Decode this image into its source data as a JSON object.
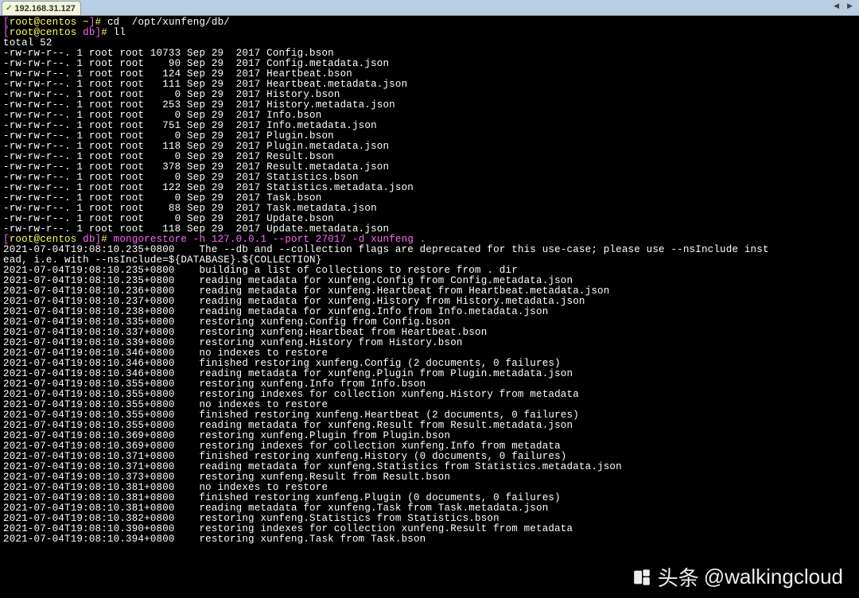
{
  "tab": {
    "label": "192.168.31.127",
    "check": "✓"
  },
  "tab_controls": {
    "left": "◀",
    "right": "▶"
  },
  "prompt": {
    "lb": "[",
    "rb": "]",
    "user": "root",
    "at": "@",
    "host": "centos",
    "hash": "#",
    "tilde": "~",
    "db": "db"
  },
  "cmds": {
    "cd": "cd  /opt/xunfeng/db/",
    "ll": "ll",
    "mongo": "mongorestore -h 127.0.0.1 --port 27017 -d xunfeng ."
  },
  "files_header": "total 52",
  "files": [
    {
      "perm": "-rw-rw-r--.",
      "n": "1",
      "o": "root",
      "g": "root",
      "size": "10733",
      "m": "Sep",
      "d": "29",
      "y": "2017",
      "name": "Config.bson"
    },
    {
      "perm": "-rw-rw-r--.",
      "n": "1",
      "o": "root",
      "g": "root",
      "size": "90",
      "m": "Sep",
      "d": "29",
      "y": "2017",
      "name": "Config.metadata.json"
    },
    {
      "perm": "-rw-rw-r--.",
      "n": "1",
      "o": "root",
      "g": "root",
      "size": "124",
      "m": "Sep",
      "d": "29",
      "y": "2017",
      "name": "Heartbeat.bson"
    },
    {
      "perm": "-rw-rw-r--.",
      "n": "1",
      "o": "root",
      "g": "root",
      "size": "111",
      "m": "Sep",
      "d": "29",
      "y": "2017",
      "name": "Heartbeat.metadata.json"
    },
    {
      "perm": "-rw-rw-r--.",
      "n": "1",
      "o": "root",
      "g": "root",
      "size": "0",
      "m": "Sep",
      "d": "29",
      "y": "2017",
      "name": "History.bson"
    },
    {
      "perm": "-rw-rw-r--.",
      "n": "1",
      "o": "root",
      "g": "root",
      "size": "253",
      "m": "Sep",
      "d": "29",
      "y": "2017",
      "name": "History.metadata.json"
    },
    {
      "perm": "-rw-rw-r--.",
      "n": "1",
      "o": "root",
      "g": "root",
      "size": "0",
      "m": "Sep",
      "d": "29",
      "y": "2017",
      "name": "Info.bson"
    },
    {
      "perm": "-rw-rw-r--.",
      "n": "1",
      "o": "root",
      "g": "root",
      "size": "751",
      "m": "Sep",
      "d": "29",
      "y": "2017",
      "name": "Info.metadata.json"
    },
    {
      "perm": "-rw-rw-r--.",
      "n": "1",
      "o": "root",
      "g": "root",
      "size": "0",
      "m": "Sep",
      "d": "29",
      "y": "2017",
      "name": "Plugin.bson"
    },
    {
      "perm": "-rw-rw-r--.",
      "n": "1",
      "o": "root",
      "g": "root",
      "size": "118",
      "m": "Sep",
      "d": "29",
      "y": "2017",
      "name": "Plugin.metadata.json"
    },
    {
      "perm": "-rw-rw-r--.",
      "n": "1",
      "o": "root",
      "g": "root",
      "size": "0",
      "m": "Sep",
      "d": "29",
      "y": "2017",
      "name": "Result.bson"
    },
    {
      "perm": "-rw-rw-r--.",
      "n": "1",
      "o": "root",
      "g": "root",
      "size": "378",
      "m": "Sep",
      "d": "29",
      "y": "2017",
      "name": "Result.metadata.json"
    },
    {
      "perm": "-rw-rw-r--.",
      "n": "1",
      "o": "root",
      "g": "root",
      "size": "0",
      "m": "Sep",
      "d": "29",
      "y": "2017",
      "name": "Statistics.bson"
    },
    {
      "perm": "-rw-rw-r--.",
      "n": "1",
      "o": "root",
      "g": "root",
      "size": "122",
      "m": "Sep",
      "d": "29",
      "y": "2017",
      "name": "Statistics.metadata.json"
    },
    {
      "perm": "-rw-rw-r--.",
      "n": "1",
      "o": "root",
      "g": "root",
      "size": "0",
      "m": "Sep",
      "d": "29",
      "y": "2017",
      "name": "Task.bson"
    },
    {
      "perm": "-rw-rw-r--.",
      "n": "1",
      "o": "root",
      "g": "root",
      "size": "88",
      "m": "Sep",
      "d": "29",
      "y": "2017",
      "name": "Task.metadata.json"
    },
    {
      "perm": "-rw-rw-r--.",
      "n": "1",
      "o": "root",
      "g": "root",
      "size": "0",
      "m": "Sep",
      "d": "29",
      "y": "2017",
      "name": "Update.bson"
    },
    {
      "perm": "-rw-rw-r--.",
      "n": "1",
      "o": "root",
      "g": "root",
      "size": "118",
      "m": "Sep",
      "d": "29",
      "y": "2017",
      "name": "Update.metadata.json"
    }
  ],
  "log_lines": [
    {
      "ts": "2021-07-04T19:08:10.235+0800",
      "msg": "The --db and --collection flags are deprecated for this use-case; please use --nsInclude inst"
    },
    {
      "ts": "ead, i.e. with --nsInclude=${DATABASE}.${COLLECTION}",
      "msg": ""
    },
    {
      "ts": "2021-07-04T19:08:10.235+0800",
      "msg": "building a list of collections to restore from . dir"
    },
    {
      "ts": "2021-07-04T19:08:10.235+0800",
      "msg": "reading metadata for xunfeng.Config from Config.metadata.json"
    },
    {
      "ts": "2021-07-04T19:08:10.236+0800",
      "msg": "reading metadata for xunfeng.Heartbeat from Heartbeat.metadata.json"
    },
    {
      "ts": "2021-07-04T19:08:10.237+0800",
      "msg": "reading metadata for xunfeng.History from History.metadata.json"
    },
    {
      "ts": "2021-07-04T19:08:10.238+0800",
      "msg": "reading metadata for xunfeng.Info from Info.metadata.json"
    },
    {
      "ts": "2021-07-04T19:08:10.335+0800",
      "msg": "restoring xunfeng.Config from Config.bson"
    },
    {
      "ts": "2021-07-04T19:08:10.337+0800",
      "msg": "restoring xunfeng.Heartbeat from Heartbeat.bson"
    },
    {
      "ts": "2021-07-04T19:08:10.339+0800",
      "msg": "restoring xunfeng.History from History.bson"
    },
    {
      "ts": "2021-07-04T19:08:10.346+0800",
      "msg": "no indexes to restore"
    },
    {
      "ts": "2021-07-04T19:08:10.346+0800",
      "msg": "finished restoring xunfeng.Config (2 documents, 0 failures)"
    },
    {
      "ts": "2021-07-04T19:08:10.346+0800",
      "msg": "reading metadata for xunfeng.Plugin from Plugin.metadata.json"
    },
    {
      "ts": "2021-07-04T19:08:10.355+0800",
      "msg": "restoring xunfeng.Info from Info.bson"
    },
    {
      "ts": "2021-07-04T19:08:10.355+0800",
      "msg": "restoring indexes for collection xunfeng.History from metadata"
    },
    {
      "ts": "2021-07-04T19:08:10.355+0800",
      "msg": "no indexes to restore"
    },
    {
      "ts": "2021-07-04T19:08:10.355+0800",
      "msg": "finished restoring xunfeng.Heartbeat (2 documents, 0 failures)"
    },
    {
      "ts": "2021-07-04T19:08:10.355+0800",
      "msg": "reading metadata for xunfeng.Result from Result.metadata.json"
    },
    {
      "ts": "2021-07-04T19:08:10.369+0800",
      "msg": "restoring xunfeng.Plugin from Plugin.bson"
    },
    {
      "ts": "2021-07-04T19:08:10.369+0800",
      "msg": "restoring indexes for collection xunfeng.Info from metadata"
    },
    {
      "ts": "2021-07-04T19:08:10.371+0800",
      "msg": "finished restoring xunfeng.History (0 documents, 0 failures)"
    },
    {
      "ts": "2021-07-04T19:08:10.371+0800",
      "msg": "reading metadata for xunfeng.Statistics from Statistics.metadata.json"
    },
    {
      "ts": "2021-07-04T19:08:10.373+0800",
      "msg": "restoring xunfeng.Result from Result.bson"
    },
    {
      "ts": "2021-07-04T19:08:10.381+0800",
      "msg": "no indexes to restore"
    },
    {
      "ts": "2021-07-04T19:08:10.381+0800",
      "msg": "finished restoring xunfeng.Plugin (0 documents, 0 failures)"
    },
    {
      "ts": "2021-07-04T19:08:10.381+0800",
      "msg": "reading metadata for xunfeng.Task from Task.metadata.json"
    },
    {
      "ts": "2021-07-04T19:08:10.382+0800",
      "msg": "restoring xunfeng.Statistics from Statistics.bson"
    },
    {
      "ts": "2021-07-04T19:08:10.390+0800",
      "msg": "restoring indexes for collection xunfeng.Result from metadata"
    },
    {
      "ts": "2021-07-04T19:08:10.394+0800",
      "msg": "restoring xunfeng.Task from Task.bson"
    }
  ],
  "watermark": {
    "prefix": "头条",
    "handle": "@walkingcloud"
  }
}
